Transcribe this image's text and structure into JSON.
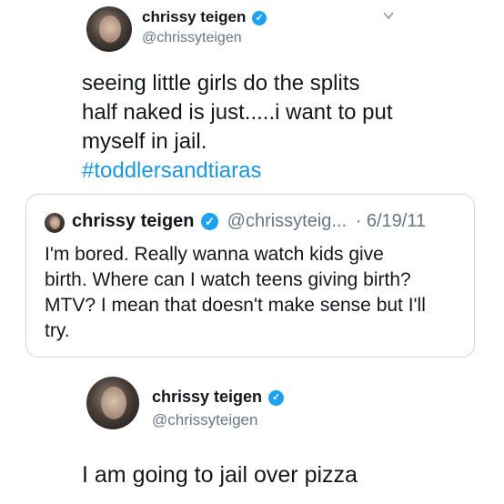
{
  "tweet1": {
    "name": "chrissy teigen",
    "handle": "@chrissyteigen",
    "text_lines": [
      "seeing little girls do the splits",
      "half naked is just.....i want to put",
      "myself in jail."
    ],
    "hashtag": "#toddlersandtiaras"
  },
  "quote": {
    "name": "chrissy teigen",
    "handle": "@chrissyteig...",
    "date": "· 6/19/11",
    "text_lines": [
      "I'm bored. Really wanna watch kids give",
      "birth. Where can I watch teens giving birth?",
      "MTV? I mean that doesn't make sense but I'll",
      "try."
    ]
  },
  "tweet2": {
    "name": "chrissy teigen",
    "handle": "@chrissyteigen",
    "text": "I am going to jail over pizza"
  },
  "icons": {
    "verified": "✓",
    "chevron": "chevron-down-icon"
  },
  "colors": {
    "verified_blue": "#1da1f2",
    "hashtag_blue": "#1b95e0",
    "handle_gray": "#657786",
    "border": "#ccd6dd"
  }
}
